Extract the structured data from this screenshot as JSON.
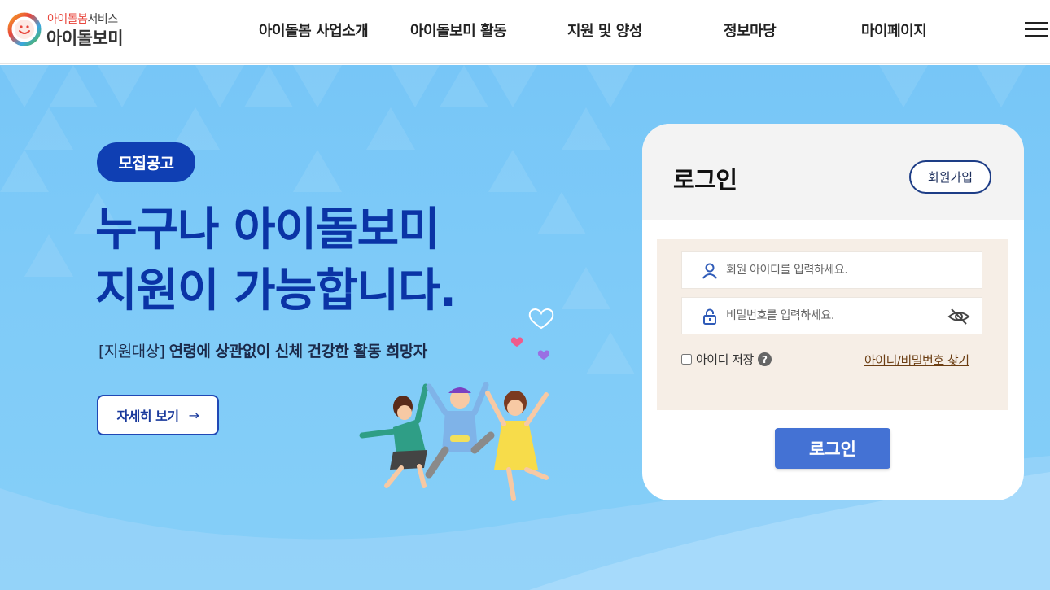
{
  "header": {
    "logo_sub_red": "아이돌봄",
    "logo_sub_gray": "서비스",
    "logo_main": "아이돌보미",
    "nav": [
      "아이돌봄 사업소개",
      "아이돌보미 활동",
      "지원 및 양성",
      "정보마당",
      "마이페이지"
    ],
    "menu_icon": "hamburger-menu-icon"
  },
  "hero": {
    "badge": "모집공고",
    "headline_1": "누구나 아이돌보미",
    "headline_2": "지원이 가능합니다.",
    "sub_label": "[지원대상]",
    "sub_text": "연령에 상관없이 신체 건강한 활동 희망자",
    "detail_button": "자세히 보기",
    "detail_arrow": "→"
  },
  "login": {
    "title": "로그인",
    "join_button": "회원가입",
    "id_placeholder": "회원 아이디를 입력하세요.",
    "pw_placeholder": "비밀번호를 입력하세요.",
    "remember_label": "아이디 저장",
    "help_mark": "?",
    "find_link": "아이디/비밀번호 찾기",
    "submit_button": "로그인"
  },
  "colors": {
    "brand_blue": "#0f3fb3",
    "headline_blue": "#0a34a6",
    "login_button": "#4472d4",
    "form_bg": "#f6eee6",
    "hero_bg": "#7fcbf8"
  }
}
